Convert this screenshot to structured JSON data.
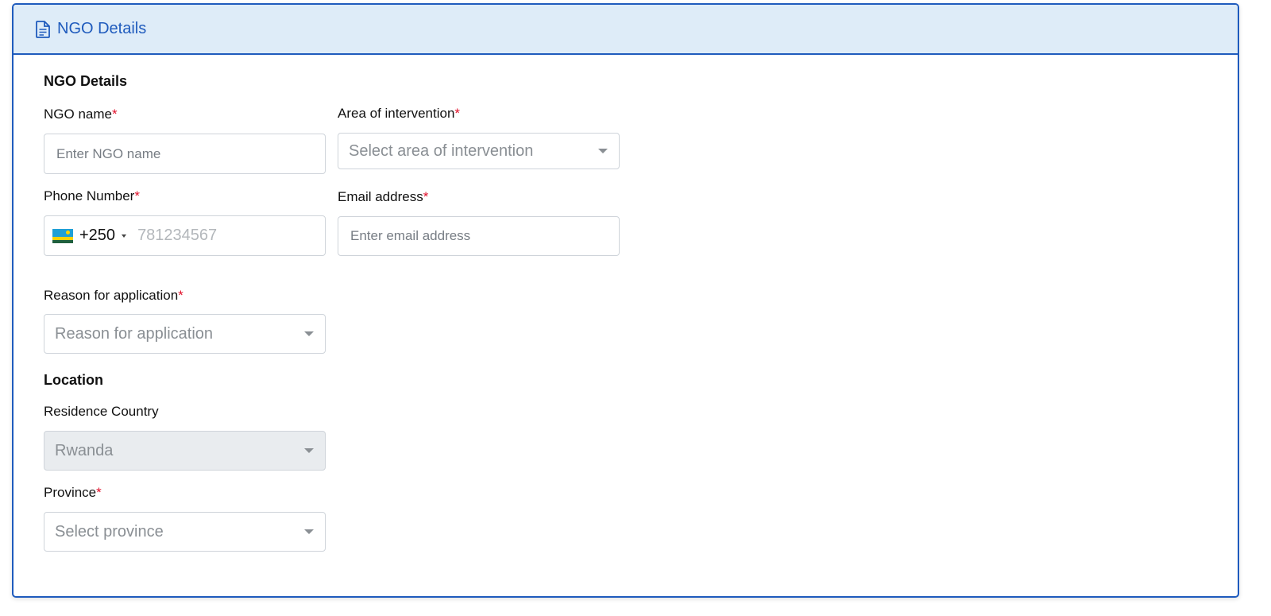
{
  "header": {
    "title": "NGO Details",
    "icon": "document-icon",
    "accent_color": "#1f5bbd",
    "background_color": "#deecf8"
  },
  "ngo_section": {
    "title": "NGO Details",
    "ngo_name": {
      "label": "NGO name",
      "required_mark": "*",
      "placeholder": "Enter NGO name"
    },
    "area_of_intervention": {
      "label": "Area of intervention",
      "required_mark": "*",
      "placeholder": "Select area of intervention"
    },
    "phone_number": {
      "label": "Phone Number",
      "required_mark": "*",
      "country_flag": "rwanda-flag-icon",
      "dial_code": "+250",
      "placeholder": "781234567"
    },
    "email_address": {
      "label": "Email address",
      "required_mark": "*",
      "placeholder": "Enter email address"
    },
    "reason_for_application": {
      "label": "Reason for application",
      "required_mark": "*",
      "placeholder": "Reason for application"
    }
  },
  "location_section": {
    "title": "Location",
    "residence_country": {
      "label": "Residence Country",
      "value": "Rwanda",
      "disabled": true
    },
    "province": {
      "label": "Province",
      "required_mark": "*",
      "placeholder": "Select province"
    }
  }
}
